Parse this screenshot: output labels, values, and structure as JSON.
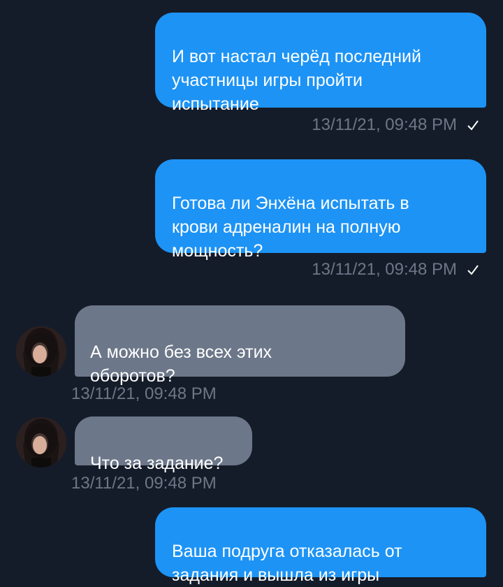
{
  "messages": [
    {
      "text": "И вот настал черёд последний\nучастницы игры пройти\nиспытание",
      "time": "13/11/21, 09:48 PM"
    },
    {
      "text": "Готова ли Энхёна испытать в\nкрови адреналин на полную\nмощность?",
      "time": "13/11/21, 09:48 PM"
    },
    {
      "text": "А можно без всех этих\nоборотов?",
      "time": "13/11/21, 09:48 PM"
    },
    {
      "text": "Что за задание?",
      "time": "13/11/21, 09:48 PM"
    },
    {
      "text": "Ваша подруга отказалась от\nзадания и вышла из игры"
    }
  ],
  "icons": {
    "read": "check-icon",
    "avatar": "avatar-photo"
  },
  "colors": {
    "background": "#151c29",
    "outgoing_bubble": "#1d93f5",
    "incoming_bubble": "#6c7789",
    "timestamp": "#6d7788"
  }
}
